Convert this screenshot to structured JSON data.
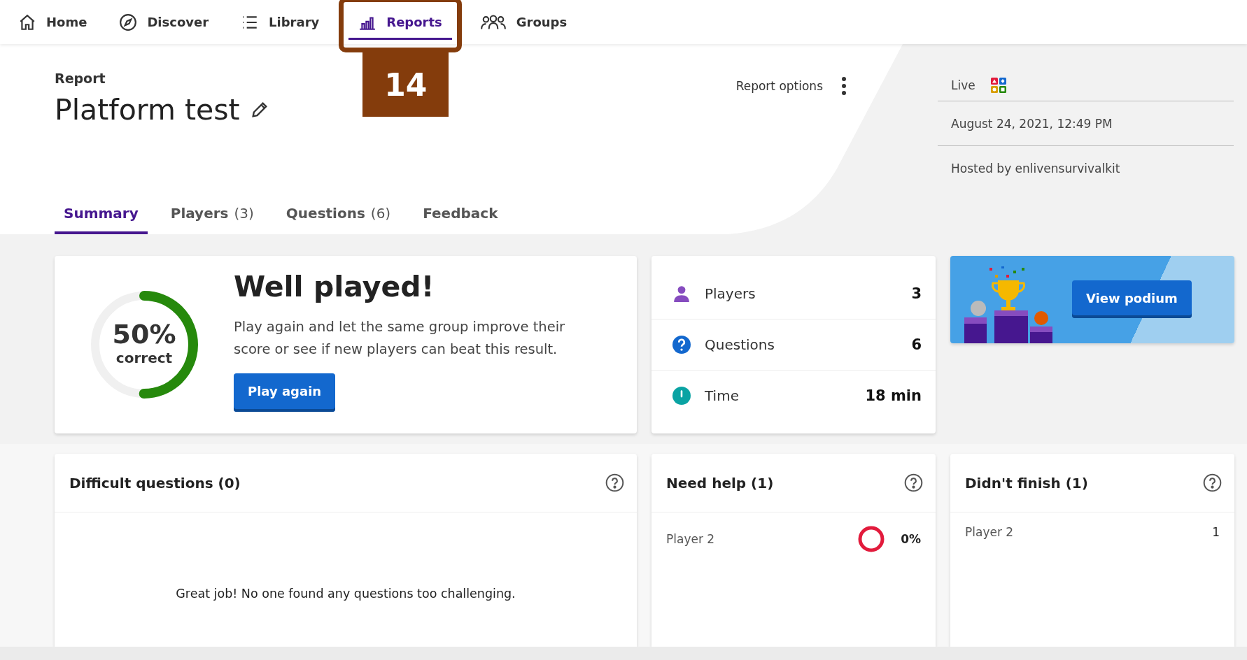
{
  "nav": [
    {
      "label": "Home",
      "kind": "home",
      "selected": false
    },
    {
      "label": "Discover",
      "kind": "compass",
      "selected": false
    },
    {
      "label": "Library",
      "kind": "list",
      "selected": false
    },
    {
      "label": "Reports",
      "kind": "chart",
      "selected": true,
      "callout": "14"
    },
    {
      "label": "Groups",
      "kind": "people",
      "selected": false
    }
  ],
  "header": {
    "eyebrow": "Report",
    "title": "Platform test",
    "options_label": "Report options"
  },
  "meta": {
    "mode": "Live",
    "date": "August 24, 2021, 12:49 PM",
    "host": "Hosted by enlivensurvivalkit"
  },
  "tabs": [
    {
      "label": "Summary",
      "selected": true
    },
    {
      "label": "Players",
      "count": "(3)",
      "selected": false
    },
    {
      "label": "Questions",
      "count": "(6)",
      "selected": false
    },
    {
      "label": "Feedback",
      "selected": false
    }
  ],
  "summary": {
    "percent": "50%",
    "caption": "correct",
    "level": 0.5,
    "heading": "Well played!",
    "text": "Play again and let the same group improve their score or see if new players can beat this result.",
    "button": "Play again"
  },
  "stats": [
    {
      "kind": "players",
      "label": "Players",
      "value": "3"
    },
    {
      "kind": "questions",
      "label": "Questions",
      "value": "6"
    },
    {
      "kind": "time",
      "label": "Time",
      "value": "18 min"
    }
  ],
  "podium": {
    "button": "View podium"
  },
  "panels": [
    {
      "title": "Difficult questions (0)",
      "empty": "Great job! No one found any questions too challenging."
    },
    {
      "title": "Need help (1)",
      "rows": [
        {
          "name": "Player 2",
          "kind": "ring",
          "value": "0%"
        }
      ]
    },
    {
      "title": "Didn't finish (1)",
      "rows": [
        {
          "name": "Player 2",
          "kind": "plain",
          "value": "1"
        }
      ]
    }
  ]
}
